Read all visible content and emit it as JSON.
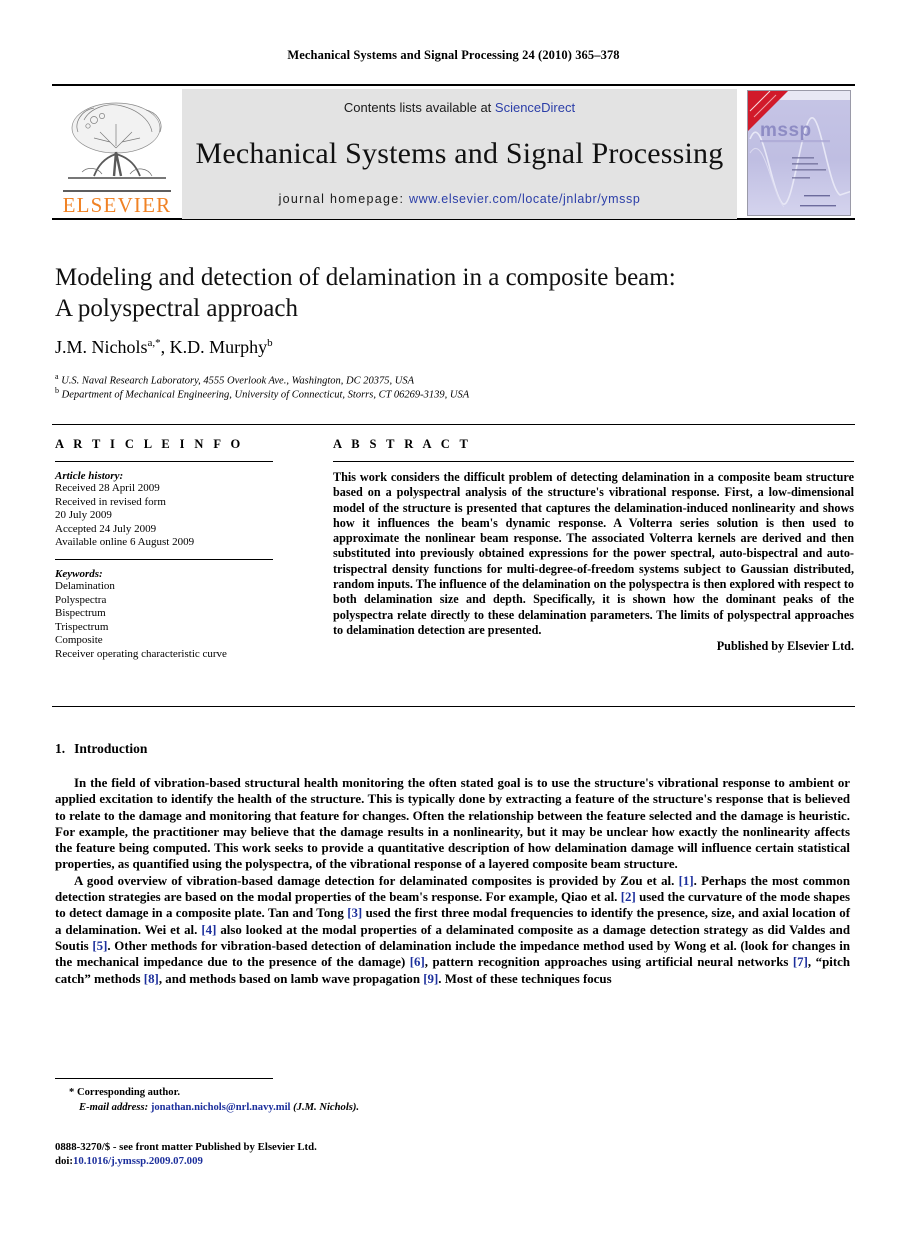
{
  "running_head": "Mechanical Systems and Signal Processing 24 (2010) 365–378",
  "masthead": {
    "publisher_logo_word": "ELSEVIER",
    "contents_prefix": "Contents lists available at ",
    "contents_link": "ScienceDirect",
    "journal_name": "Mechanical Systems and Signal Processing",
    "homepage_prefix": "journal homepage: ",
    "homepage_url": "www.elsevier.com/locate/jnlabr/ymssp",
    "cover_title": "mssp",
    "cover_banner": "Mechanical Systems and Signal Processing",
    "link_color": "#2b3ea8",
    "logo_color": "#F08224",
    "panel_color": "#e3e3e3"
  },
  "article": {
    "title_line1": "Modeling and detection of delamination in a composite beam:",
    "title_line2": "A polyspectral approach",
    "authors": [
      {
        "name": "J.M. Nichols",
        "marks": "a,*"
      },
      {
        "name": "K.D. Murphy",
        "marks": "b"
      }
    ],
    "affiliations": [
      {
        "mark": "a",
        "text": "U.S. Naval Research Laboratory, 4555 Overlook Ave., Washington, DC 20375, USA"
      },
      {
        "mark": "b",
        "text": "Department of Mechanical Engineering, University of Connecticut, Storrs, CT 06269-3139, USA"
      }
    ]
  },
  "article_info": {
    "heading": "A R T I C L E   I N F O",
    "history_heading": "Article history:",
    "history": [
      "Received 28 April 2009",
      "Received in revised form",
      "20 July 2009",
      "Accepted 24 July 2009",
      "Available online 6 August 2009"
    ],
    "keywords_heading": "Keywords:",
    "keywords": [
      "Delamination",
      "Polyspectra",
      "Bispectrum",
      "Trispectrum",
      "Composite",
      "Receiver operating characteristic curve"
    ]
  },
  "abstract": {
    "heading": "A B S T R A C T",
    "body": "This work considers the difficult problem of detecting delamination in a composite beam structure based on a polyspectral analysis of the structure's vibrational response. First, a low-dimensional model of the structure is presented that captures the delamination-induced nonlinearity and shows how it influences the beam's dynamic response. A Volterra series solution is then used to approximate the nonlinear beam response. The associated Volterra kernels are derived and then substituted into previously obtained expressions for the power spectral, auto-bispectral and auto-trispectral density functions for multi-degree-of-freedom systems subject to Gaussian distributed, random inputs. The influence of the delamination on the polyspectra is then explored with respect to both delamination size and depth. Specifically, it is shown how the dominant peaks of the polyspectra relate directly to these delamination parameters. The limits of polyspectral approaches to delamination detection are presented.",
    "publisher_note": "Published by Elsevier Ltd."
  },
  "section": {
    "number": "1.",
    "title": "Introduction"
  },
  "body_paragraphs": [
    {
      "id": "p1",
      "parts": [
        {
          "t": "In the field of vibration-based structural health monitoring the often stated goal is to use the structure's vibrational response to ambient or applied excitation to identify the health of the structure. This is typically done by extracting a feature of the structure's response that is believed to relate to the damage and monitoring that feature for changes. Often the relationship between the feature selected and the damage is heuristic. For example, the practitioner may believe that the damage results in a nonlinearity, but it may be unclear how exactly the nonlinearity affects the feature being computed. This work seeks to provide a quantitative description of how delamination damage will influence certain statistical properties, as quantified using the polyspectra, of the vibrational response of a layered composite beam structure."
        }
      ]
    },
    {
      "id": "p2",
      "parts": [
        {
          "t": "A good overview of vibration-based damage detection for delaminated composites is provided by Zou et al. "
        },
        {
          "t": "[1]",
          "cite": true
        },
        {
          "t": ". Perhaps the most common detection strategies are based on the modal properties of the beam's response. For example, Qiao et al. "
        },
        {
          "t": "[2]",
          "cite": true
        },
        {
          "t": " used the curvature of the mode shapes to detect damage in a composite plate. Tan and Tong "
        },
        {
          "t": "[3]",
          "cite": true
        },
        {
          "t": " used the first three modal frequencies to identify the presence, size, and axial location of a delamination. Wei et al. "
        },
        {
          "t": "[4]",
          "cite": true
        },
        {
          "t": " also looked at the modal properties of a delaminated composite as a damage detection strategy as did Valdes and Soutis "
        },
        {
          "t": "[5]",
          "cite": true
        },
        {
          "t": ". Other methods for vibration-based detection of delamination include the impedance method used by Wong et al. (look for changes in the mechanical impedance due to the presence of the damage) "
        },
        {
          "t": "[6]",
          "cite": true
        },
        {
          "t": ", pattern recognition approaches using artificial neural networks "
        },
        {
          "t": "[7]",
          "cite": true
        },
        {
          "t": ", “pitch catch” methods "
        },
        {
          "t": "[8]",
          "cite": true
        },
        {
          "t": ", and methods based on lamb wave propagation "
        },
        {
          "t": "[9]",
          "cite": true
        },
        {
          "t": ". Most of these techniques focus"
        }
      ]
    }
  ],
  "footnotes": {
    "corresponding": "* Corresponding author.",
    "email_label": "E-mail address:",
    "email": "jonathan.nichols@nrl.navy.mil",
    "email_suffix": "(J.M. Nichols)."
  },
  "imprint": {
    "issn_line": "0888-3270/$ - see front matter Published by Elsevier Ltd.",
    "doi_label": "doi:",
    "doi_value": "10.1016/j.ymssp.2009.07.009"
  }
}
